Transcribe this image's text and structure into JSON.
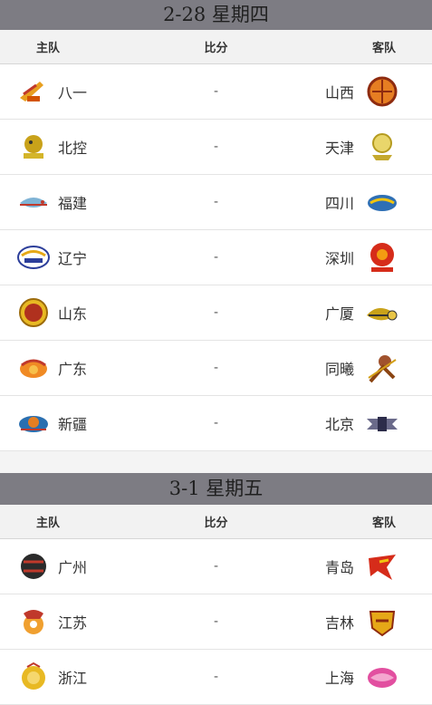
{
  "days": [
    {
      "date_label": "2-28 星期四",
      "headers": {
        "home": "主队",
        "score": "比分",
        "away": "客队"
      },
      "games": [
        {
          "home": "八一",
          "score": "-",
          "away": "山西",
          "home_icon": "bayi-rockets-logo-icon",
          "away_icon": "shanxi-brave-dragons-logo-icon"
        },
        {
          "home": "北控",
          "score": "-",
          "away": "天津",
          "home_icon": "beikong-fly-dragons-logo-icon",
          "away_icon": "tianjin-pioneers-logo-icon"
        },
        {
          "home": "福建",
          "score": "-",
          "away": "四川",
          "home_icon": "fujian-sturgeons-logo-icon",
          "away_icon": "sichuan-blue-whales-logo-icon"
        },
        {
          "home": "辽宁",
          "score": "-",
          "away": "深圳",
          "home_icon": "liaoning-flying-leopards-logo-icon",
          "away_icon": "shenzhen-leopards-logo-icon"
        },
        {
          "home": "山东",
          "score": "-",
          "away": "广厦",
          "home_icon": "shandong-heroes-logo-icon",
          "away_icon": "guangsha-lions-logo-icon"
        },
        {
          "home": "广东",
          "score": "-",
          "away": "同曦",
          "home_icon": "guangdong-tigers-logo-icon",
          "away_icon": "tongxi-monkey-kings-logo-icon"
        },
        {
          "home": "新疆",
          "score": "-",
          "away": "北京",
          "home_icon": "xinjiang-tigers-logo-icon",
          "away_icon": "beijing-ducks-logo-icon"
        }
      ]
    },
    {
      "date_label": "3-1 星期五",
      "headers": {
        "home": "主队",
        "score": "比分",
        "away": "客队"
      },
      "games": [
        {
          "home": "广州",
          "score": "-",
          "away": "青岛",
          "home_icon": "guangzhou-loong-lions-logo-icon",
          "away_icon": "qingdao-eagles-logo-icon"
        },
        {
          "home": "江苏",
          "score": "-",
          "away": "吉林",
          "home_icon": "jiangsu-dragons-logo-icon",
          "away_icon": "jilin-tigers-logo-icon"
        },
        {
          "home": "浙江",
          "score": "-",
          "away": "上海",
          "home_icon": "zhejiang-lions-logo-icon",
          "away_icon": "shanghai-sharks-logo-icon"
        }
      ]
    }
  ]
}
